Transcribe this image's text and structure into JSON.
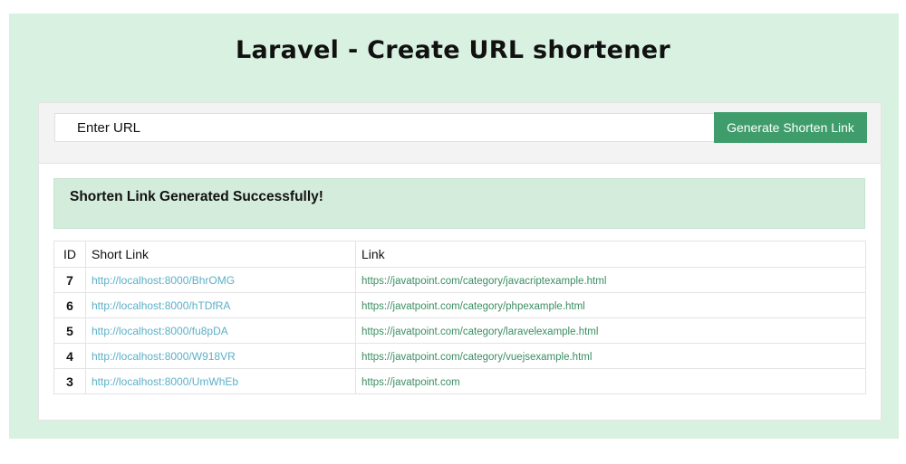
{
  "title": "Laravel - Create URL shortener",
  "form": {
    "input_placeholder": "Enter URL",
    "button_label": "Generate Shorten Link"
  },
  "alert": "Shorten Link Generated Successfully!",
  "table": {
    "headers": {
      "id": "ID",
      "short": "Short Link",
      "link": "Link"
    },
    "rows": [
      {
        "id": "7",
        "short": "http://localhost:8000/BhrOMG",
        "link": "https://javatpoint.com/category/javacriptexample.html"
      },
      {
        "id": "6",
        "short": "http://localhost:8000/hTDfRA",
        "link": "https://javatpoint.com/category/phpexample.html"
      },
      {
        "id": "5",
        "short": "http://localhost:8000/fu8pDA",
        "link": "https://javatpoint.com/category/laravelexample.html"
      },
      {
        "id": "4",
        "short": "http://localhost:8000/W918VR",
        "link": "https://javatpoint.com/category/vuejsexample.html"
      },
      {
        "id": "3",
        "short": "http://localhost:8000/UmWhEb",
        "link": "https://javatpoint.com"
      }
    ]
  },
  "colors": {
    "page_background": "#d9f1e0",
    "button": "#3f9d6b",
    "alert_background": "#d4ecdb",
    "short_link": "#5ab0c8",
    "long_link": "#3a8e62"
  }
}
